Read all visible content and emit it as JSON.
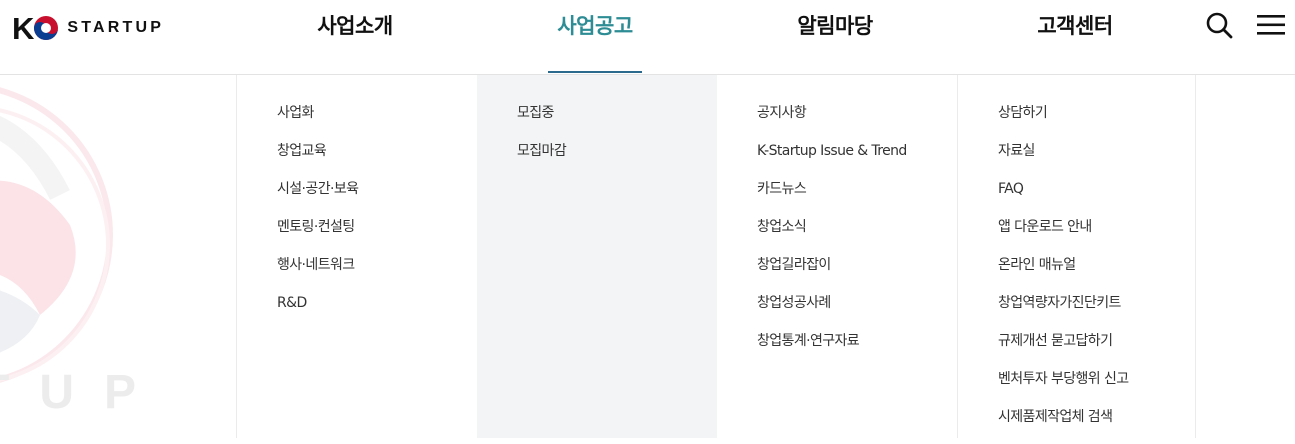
{
  "logo": {
    "letter": "K",
    "text": "STARTUP"
  },
  "nav": [
    {
      "label": "사업소개",
      "active": false
    },
    {
      "label": "사업공고",
      "active": true
    },
    {
      "label": "알림마당",
      "active": false
    },
    {
      "label": "고객센터",
      "active": false
    }
  ],
  "icons": {
    "search": "search-icon",
    "menu": "hamburger-menu-icon"
  },
  "colors": {
    "active": "#2d8c94",
    "underline": "#2b6a8d",
    "highlight_column_bg": "#f3f4f6"
  },
  "background_text": "TUP",
  "columns": [
    {
      "items": [
        "사업화",
        "창업교육",
        "시설·공간·보육",
        "멘토링·컨설팅",
        "행사·네트워크",
        "R&D"
      ]
    },
    {
      "items": [
        "모집중",
        "모집마감"
      ]
    },
    {
      "items": [
        "공지사항",
        "K-Startup Issue & Trend",
        "카드뉴스",
        "창업소식",
        "창업길라잡이",
        "창업성공사례",
        "창업통계·연구자료"
      ]
    },
    {
      "items": [
        "상담하기",
        "자료실",
        "FAQ",
        "앱 다운로드 안내",
        "온라인 매뉴얼",
        "창업역량자가진단키트",
        "규제개선 묻고답하기",
        "벤처투자 부당행위 신고",
        "시제품제작업체 검색"
      ]
    }
  ]
}
